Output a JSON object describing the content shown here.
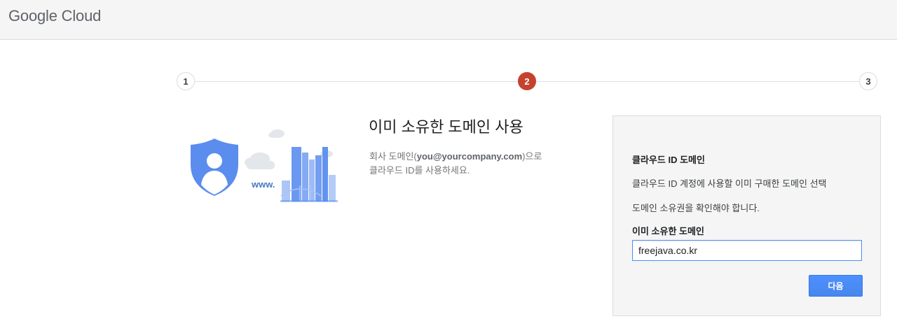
{
  "header": {
    "logo_text": "Google Cloud"
  },
  "stepper": {
    "steps": [
      "1",
      "2",
      "3"
    ],
    "current": 2
  },
  "intro": {
    "title": "이미 소유한 도메인 사용",
    "desc_prefix": "회사 도메인(",
    "desc_bold": "you@yourcompany.com",
    "desc_suffix": ")으로",
    "desc_line2": "클라우드 ID를 사용하세요.",
    "illustration_text": "www."
  },
  "panel": {
    "title": "클라우드 ID 도메인",
    "text1": "클라우드 ID 계정에 사용할 이미 구매한 도메인 선택",
    "text2": "도메인 소유권을 확인해야 합니다.",
    "field_label": "이미 소유한 도메인",
    "field_value": "freejava.co.kr",
    "next_label": "다음"
  },
  "colors": {
    "accent": "#4d90fe",
    "active_step": "#c5432e",
    "illustration_blue": "#5b8def"
  },
  "icons": [
    "shield-user-icon",
    "cloud-icon",
    "city-skyline-icon"
  ]
}
